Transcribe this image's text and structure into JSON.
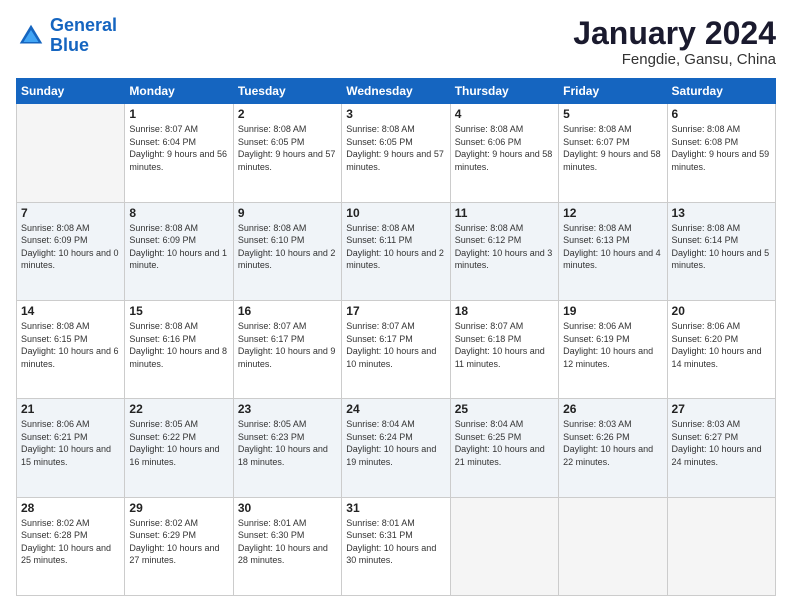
{
  "logo": {
    "line1": "General",
    "line2": "Blue"
  },
  "title": "January 2024",
  "subtitle": "Fengdie, Gansu, China",
  "headers": [
    "Sunday",
    "Monday",
    "Tuesday",
    "Wednesday",
    "Thursday",
    "Friday",
    "Saturday"
  ],
  "weeks": [
    [
      {
        "day": "",
        "sunrise": "",
        "sunset": "",
        "daylight": ""
      },
      {
        "day": "1",
        "sunrise": "Sunrise: 8:07 AM",
        "sunset": "Sunset: 6:04 PM",
        "daylight": "Daylight: 9 hours and 56 minutes."
      },
      {
        "day": "2",
        "sunrise": "Sunrise: 8:08 AM",
        "sunset": "Sunset: 6:05 PM",
        "daylight": "Daylight: 9 hours and 57 minutes."
      },
      {
        "day": "3",
        "sunrise": "Sunrise: 8:08 AM",
        "sunset": "Sunset: 6:05 PM",
        "daylight": "Daylight: 9 hours and 57 minutes."
      },
      {
        "day": "4",
        "sunrise": "Sunrise: 8:08 AM",
        "sunset": "Sunset: 6:06 PM",
        "daylight": "Daylight: 9 hours and 58 minutes."
      },
      {
        "day": "5",
        "sunrise": "Sunrise: 8:08 AM",
        "sunset": "Sunset: 6:07 PM",
        "daylight": "Daylight: 9 hours and 58 minutes."
      },
      {
        "day": "6",
        "sunrise": "Sunrise: 8:08 AM",
        "sunset": "Sunset: 6:08 PM",
        "daylight": "Daylight: 9 hours and 59 minutes."
      }
    ],
    [
      {
        "day": "7",
        "sunrise": "Sunrise: 8:08 AM",
        "sunset": "Sunset: 6:09 PM",
        "daylight": "Daylight: 10 hours and 0 minutes."
      },
      {
        "day": "8",
        "sunrise": "Sunrise: 8:08 AM",
        "sunset": "Sunset: 6:09 PM",
        "daylight": "Daylight: 10 hours and 1 minute."
      },
      {
        "day": "9",
        "sunrise": "Sunrise: 8:08 AM",
        "sunset": "Sunset: 6:10 PM",
        "daylight": "Daylight: 10 hours and 2 minutes."
      },
      {
        "day": "10",
        "sunrise": "Sunrise: 8:08 AM",
        "sunset": "Sunset: 6:11 PM",
        "daylight": "Daylight: 10 hours and 2 minutes."
      },
      {
        "day": "11",
        "sunrise": "Sunrise: 8:08 AM",
        "sunset": "Sunset: 6:12 PM",
        "daylight": "Daylight: 10 hours and 3 minutes."
      },
      {
        "day": "12",
        "sunrise": "Sunrise: 8:08 AM",
        "sunset": "Sunset: 6:13 PM",
        "daylight": "Daylight: 10 hours and 4 minutes."
      },
      {
        "day": "13",
        "sunrise": "Sunrise: 8:08 AM",
        "sunset": "Sunset: 6:14 PM",
        "daylight": "Daylight: 10 hours and 5 minutes."
      }
    ],
    [
      {
        "day": "14",
        "sunrise": "Sunrise: 8:08 AM",
        "sunset": "Sunset: 6:15 PM",
        "daylight": "Daylight: 10 hours and 6 minutes."
      },
      {
        "day": "15",
        "sunrise": "Sunrise: 8:08 AM",
        "sunset": "Sunset: 6:16 PM",
        "daylight": "Daylight: 10 hours and 8 minutes."
      },
      {
        "day": "16",
        "sunrise": "Sunrise: 8:07 AM",
        "sunset": "Sunset: 6:17 PM",
        "daylight": "Daylight: 10 hours and 9 minutes."
      },
      {
        "day": "17",
        "sunrise": "Sunrise: 8:07 AM",
        "sunset": "Sunset: 6:17 PM",
        "daylight": "Daylight: 10 hours and 10 minutes."
      },
      {
        "day": "18",
        "sunrise": "Sunrise: 8:07 AM",
        "sunset": "Sunset: 6:18 PM",
        "daylight": "Daylight: 10 hours and 11 minutes."
      },
      {
        "day": "19",
        "sunrise": "Sunrise: 8:06 AM",
        "sunset": "Sunset: 6:19 PM",
        "daylight": "Daylight: 10 hours and 12 minutes."
      },
      {
        "day": "20",
        "sunrise": "Sunrise: 8:06 AM",
        "sunset": "Sunset: 6:20 PM",
        "daylight": "Daylight: 10 hours and 14 minutes."
      }
    ],
    [
      {
        "day": "21",
        "sunrise": "Sunrise: 8:06 AM",
        "sunset": "Sunset: 6:21 PM",
        "daylight": "Daylight: 10 hours and 15 minutes."
      },
      {
        "day": "22",
        "sunrise": "Sunrise: 8:05 AM",
        "sunset": "Sunset: 6:22 PM",
        "daylight": "Daylight: 10 hours and 16 minutes."
      },
      {
        "day": "23",
        "sunrise": "Sunrise: 8:05 AM",
        "sunset": "Sunset: 6:23 PM",
        "daylight": "Daylight: 10 hours and 18 minutes."
      },
      {
        "day": "24",
        "sunrise": "Sunrise: 8:04 AM",
        "sunset": "Sunset: 6:24 PM",
        "daylight": "Daylight: 10 hours and 19 minutes."
      },
      {
        "day": "25",
        "sunrise": "Sunrise: 8:04 AM",
        "sunset": "Sunset: 6:25 PM",
        "daylight": "Daylight: 10 hours and 21 minutes."
      },
      {
        "day": "26",
        "sunrise": "Sunrise: 8:03 AM",
        "sunset": "Sunset: 6:26 PM",
        "daylight": "Daylight: 10 hours and 22 minutes."
      },
      {
        "day": "27",
        "sunrise": "Sunrise: 8:03 AM",
        "sunset": "Sunset: 6:27 PM",
        "daylight": "Daylight: 10 hours and 24 minutes."
      }
    ],
    [
      {
        "day": "28",
        "sunrise": "Sunrise: 8:02 AM",
        "sunset": "Sunset: 6:28 PM",
        "daylight": "Daylight: 10 hours and 25 minutes."
      },
      {
        "day": "29",
        "sunrise": "Sunrise: 8:02 AM",
        "sunset": "Sunset: 6:29 PM",
        "daylight": "Daylight: 10 hours and 27 minutes."
      },
      {
        "day": "30",
        "sunrise": "Sunrise: 8:01 AM",
        "sunset": "Sunset: 6:30 PM",
        "daylight": "Daylight: 10 hours and 28 minutes."
      },
      {
        "day": "31",
        "sunrise": "Sunrise: 8:01 AM",
        "sunset": "Sunset: 6:31 PM",
        "daylight": "Daylight: 10 hours and 30 minutes."
      },
      {
        "day": "",
        "sunrise": "",
        "sunset": "",
        "daylight": ""
      },
      {
        "day": "",
        "sunrise": "",
        "sunset": "",
        "daylight": ""
      },
      {
        "day": "",
        "sunrise": "",
        "sunset": "",
        "daylight": ""
      }
    ]
  ]
}
